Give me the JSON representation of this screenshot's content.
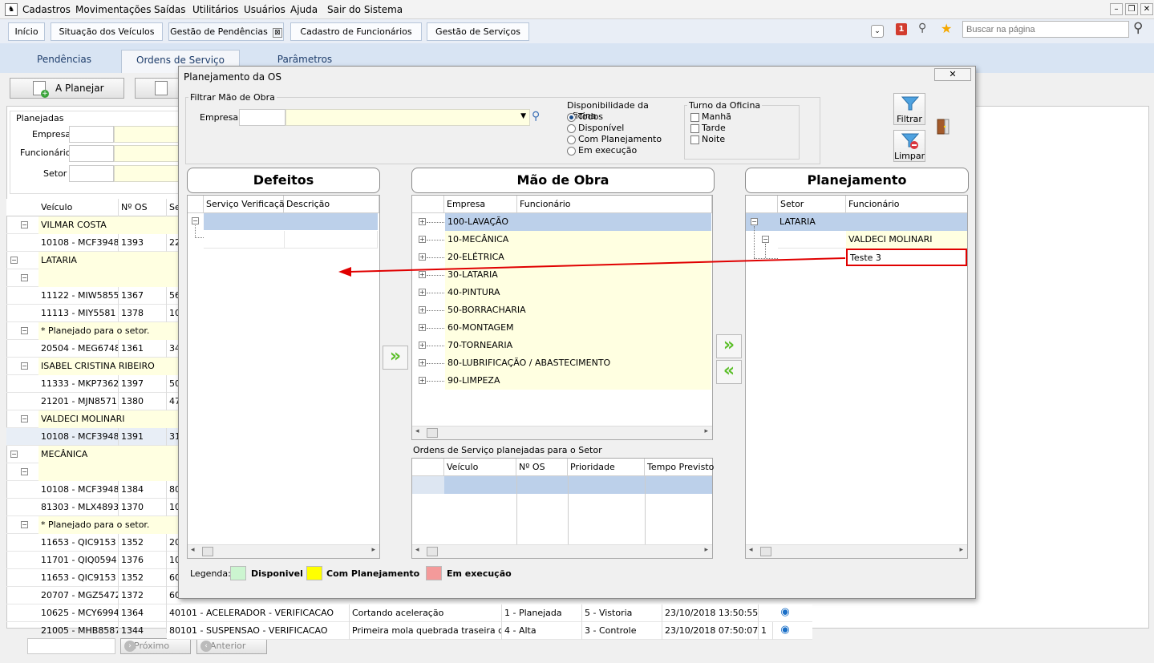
{
  "menu": {
    "items": [
      "Cadastros",
      "Movimentações",
      "Saídas",
      "Utilitários",
      "Usuários",
      "Ajuda",
      "Sair do Sistema"
    ],
    "app_icon": "app-icon"
  },
  "tabs": {
    "items": [
      "Início",
      "Situação dos Veículos",
      "Gestão de Pendências",
      "Cadastro de Funcionários",
      "Gestão de Serviços"
    ],
    "active": "Gestão de Pendências",
    "close_glyph": "⊠"
  },
  "toolbar": {
    "search_placeholder": "Buscar na página",
    "badge_count": "1"
  },
  "subtabs": {
    "items": [
      "Pendências",
      "Ordens de Serviço",
      "Parâmetros"
    ],
    "active": "Ordens de Serviço"
  },
  "main": {
    "a_planejar": "A Planejar",
    "planejadas_label": "Planejadas",
    "empresa_label": "Empresa",
    "funcionario_label": "Funcionário",
    "setor_label": "Setor",
    "col_veiculo": "Veículo",
    "col_nos": "Nº OS",
    "col_se": "Se",
    "rows": [
      {
        "type": "group",
        "text": "VILMAR COSTA"
      },
      {
        "type": "data",
        "veiculo": "10108 - MCF3948",
        "nos": "1393",
        "se": "22"
      },
      {
        "type": "setor",
        "text": "LATARIA"
      },
      {
        "type": "blank"
      },
      {
        "type": "data",
        "veiculo": "11122 - MIW5855",
        "nos": "1367",
        "se": "56"
      },
      {
        "type": "data",
        "veiculo": "11113 - MIY5581",
        "nos": "1378",
        "se": "10"
      },
      {
        "type": "group",
        "text": "* Planejado para o setor."
      },
      {
        "type": "data",
        "veiculo": "20504 - MEG6748",
        "nos": "1361",
        "se": "34"
      },
      {
        "type": "group",
        "text": "ISABEL CRISTINA RIBEIRO"
      },
      {
        "type": "data",
        "veiculo": "11333 - MKP7362",
        "nos": "1397",
        "se": "50"
      },
      {
        "type": "data",
        "veiculo": "21201 - MJN8571",
        "nos": "1380",
        "se": "47"
      },
      {
        "type": "group",
        "text": "VALDECI MOLINARI"
      },
      {
        "type": "data",
        "veiculo": "10108 - MCF3948",
        "nos": "1391",
        "se": "31"
      },
      {
        "type": "setor",
        "text": "MECÂNICA"
      },
      {
        "type": "blank"
      },
      {
        "type": "data",
        "veiculo": "10108 - MCF3948",
        "nos": "1384",
        "se": "80"
      },
      {
        "type": "data",
        "veiculo": "81303 - MLX4893",
        "nos": "1370",
        "se": "10"
      },
      {
        "type": "group",
        "text": "* Planejado para o setor."
      },
      {
        "type": "data",
        "veiculo": "11653 - QIC9153",
        "nos": "1352",
        "se": "20"
      },
      {
        "type": "data",
        "veiculo": "11701 - QIQ0594",
        "nos": "1376",
        "se": "10"
      },
      {
        "type": "data",
        "veiculo": "11653 - QIC9153",
        "nos": "1352",
        "se": "60"
      },
      {
        "type": "data",
        "veiculo": "20707 - MGZ5472",
        "nos": "1372",
        "se": "60"
      },
      {
        "type": "full",
        "veiculo": "10625 - MCY6994",
        "nos": "1364",
        "servico": "40101 - ACELERADOR - VERIFICACAO",
        "desc": "Cortando aceleração",
        "prio": "1 - Planejada",
        "status": "5 - Vistoria",
        "data": "23/10/2018 13:50:55"
      },
      {
        "type": "full",
        "veiculo": "21005 - MHB8587",
        "nos": "1344",
        "servico": "80101 - SUSPENSAO - VERIFICACAO",
        "desc": "Primeira mola quebrada traseira do",
        "prio": "4 - Alta",
        "status": "3 - Controle",
        "data": "23/10/2018 07:50:07",
        "extra": "1"
      }
    ],
    "proximo": "Próximo",
    "anterior": "Anterior"
  },
  "dialog": {
    "title": "Planejamento da OS",
    "close_glyph": "✕",
    "filtrar_mao_obra": "Filtrar Mão de Obra",
    "empresa_label": "Empresa",
    "disp_title": "Disponibilidade da oficina",
    "disp_options": [
      "Todos",
      "Disponível",
      "Com Planejamento",
      "Em execução"
    ],
    "disp_selected": "Todos",
    "turno_title": "Turno da Oficina",
    "turno_options": [
      "Manhã",
      "Tarde",
      "Noite"
    ],
    "filtrar": "Filtrar",
    "limpar": "Limpar",
    "defeitos": {
      "title": "Defeitos",
      "cols": [
        "Serviço Verificação",
        "Descrição"
      ]
    },
    "mao_obra": {
      "title": "Mão de Obra",
      "cols": [
        "Empresa",
        "Funcionário"
      ],
      "rows": [
        "100-LAVAÇÃO",
        "10-MECÂNICA",
        "20-ELÉTRICA",
        "30-LATARIA",
        "40-PINTURA",
        "50-BORRACHARIA",
        "60-MONTAGEM",
        "70-TORNEARIA",
        "80-LUBRIFICAÇÃO / ABASTECIMENTO",
        "90-LIMPEZA"
      ]
    },
    "os_planejadas": {
      "title": "Ordens de Serviço planejadas para o Setor",
      "cols": [
        "Veículo",
        "Nº OS",
        "Prioridade",
        "Tempo Previsto"
      ]
    },
    "planejamento": {
      "title": "Planejamento",
      "cols": [
        "Setor",
        "Funcionário"
      ],
      "setor": "LATARIA",
      "funcionario": "VALDECI MOLINARI",
      "item": "Teste 3"
    },
    "legenda": {
      "label": "Legenda:",
      "items": [
        {
          "text": "Disponivel",
          "color": "#ccf5d0"
        },
        {
          "text": "Com Planejamento",
          "color": "#ffff00"
        },
        {
          "text": "Em execução",
          "color": "#f49a9a"
        }
      ]
    }
  },
  "annotation_color": "#e00000"
}
